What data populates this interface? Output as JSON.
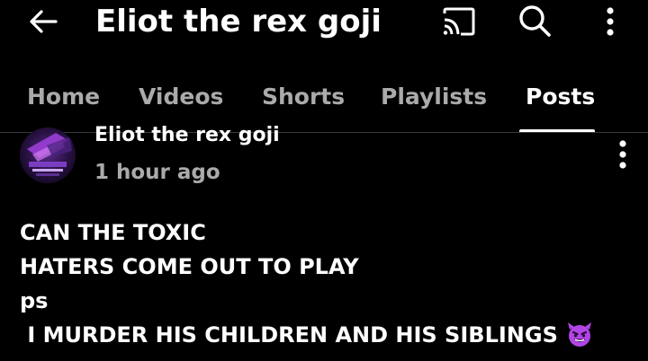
{
  "header": {
    "title": "Eliot the rex goji",
    "back_icon": "arrow-left-icon",
    "cast_icon": "cast-icon",
    "search_icon": "search-icon",
    "more_icon": "more-vertical-icon"
  },
  "tabs": [
    {
      "label": "Home",
      "active": false
    },
    {
      "label": "Videos",
      "active": false
    },
    {
      "label": "Shorts",
      "active": false
    },
    {
      "label": "Playlists",
      "active": false
    },
    {
      "label": "Posts",
      "active": true
    }
  ],
  "post": {
    "channel_name": "Eliot the rex goji",
    "time": "1 hour ago",
    "lines": [
      "CAN THE TOXIC",
      "HATERS COME OUT TO PLAY",
      "ps",
      " I MURDER HIS CHILDREN AND HIS SIBLINGS"
    ],
    "emoji_icon": "smiling-devil-emoji-icon",
    "avatar_icon": "channel-avatar"
  },
  "colors": {
    "background": "#000000",
    "text_primary": "#ffffff",
    "text_secondary": "#aaaaaa",
    "divider": "#3a3a3a",
    "emoji_purple": "#b245e6"
  }
}
